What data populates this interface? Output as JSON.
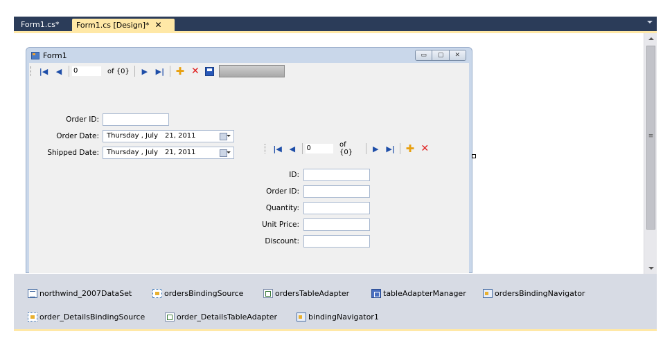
{
  "tabs": [
    {
      "label": "Form1.cs*"
    },
    {
      "label": "Form1.cs [Design]*",
      "close": "✕"
    }
  ],
  "form": {
    "title": "Form1",
    "window_buttons": [
      "▭",
      "▢",
      "✕"
    ]
  },
  "orders_navigator": {
    "position": "0",
    "count": "of {0}"
  },
  "orders_fields": {
    "order_id_label": "Order ID:",
    "order_date_label": "Order Date:",
    "shipped_date_label": "Shipped Date:",
    "order_date": {
      "day": "Thursday",
      "sep": ",",
      "month": "July",
      "date": "21, 2011"
    },
    "shipped_date": {
      "day": "Thursday",
      "sep": ",",
      "month": "July",
      "date": "21, 2011"
    }
  },
  "details_navigator": {
    "position": "0",
    "count": "of {0}"
  },
  "details_fields": {
    "id_label": "ID:",
    "order_id_label": "Order ID:",
    "quantity_label": "Quantity:",
    "unit_price_label": "Unit Price:",
    "discount_label": "Discount:"
  },
  "tray": {
    "row1": [
      "northwind_2007DataSet",
      "ordersBindingSource",
      "ordersTableAdapter",
      "tableAdapterManager",
      "ordersBindingNavigator"
    ],
    "row2": [
      "order_DetailsBindingSource",
      "order_DetailsTableAdapter",
      "bindingNavigator1"
    ]
  },
  "colors": {
    "tab_strip": "#2b3c59",
    "active_tab": "#ffe8a6",
    "form_border": "#c9d7ea",
    "tray": "#d7dbe4"
  }
}
